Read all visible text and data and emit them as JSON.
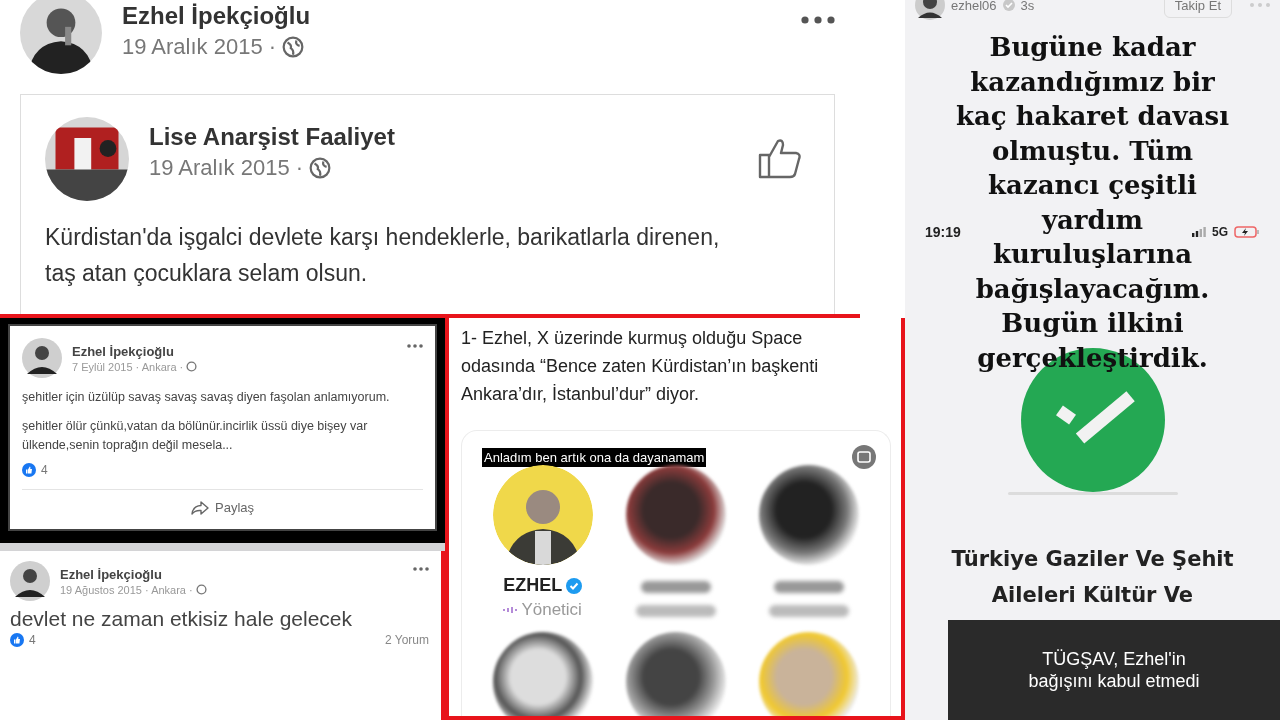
{
  "main_post": {
    "author": "Ezhel İpekçioğlu",
    "date": "19 Aralık 2015 ·",
    "shared_post": {
      "author": "Lise Anarşist Faaliyet",
      "date": "19 Aralık 2015 ·",
      "text": "Kürdistan'da işgalci devlete karşı hendeklerle, barikatlarla direnen, taş atan çocuklara selam olsun."
    }
  },
  "post_2": {
    "author": "Ezhel İpekçioğlu",
    "date": "7 Eylül 2015 · Ankara ·",
    "paragraphs": [
      "şehitler için üzülüp savaş savaş savaş diyen faşolan anlamıyorum.",
      "şehitler ölür çünkü,vatan da bölünür.incirlik üssü diye bişey var ülkende,senin toprağın değil mesela..."
    ],
    "reactions": "4",
    "share_label": "Paylaş"
  },
  "post_3": {
    "author": "Ezhel İpekçioğlu",
    "date": "19 Ağustos 2015 · Ankara ·",
    "text": "devlet ne zaman etkisiz hale gelecek",
    "reactions": "4",
    "comments": "2 Yorum"
  },
  "tweet": {
    "text": "1- Ezhel, X üzerinde kurmuş olduğu Space odasında “Bence zaten Kürdistan’ın başkenti Ankara’dır, İstanbul’dur” diyor.",
    "space": {
      "subtitle": "Anladım ben artık ona da dayanamam",
      "host": {
        "name": "EZHEL",
        "role": "Yönetici"
      }
    }
  },
  "story": {
    "username": "ezhel06",
    "time": "3s",
    "follow_label": "Takip Et",
    "text_lines": [
      "Bugüne kadar",
      "kazandığımız bir",
      "kaç hakaret davası",
      "olmuştu. Tüm",
      "kazancı çeşitli",
      "yardım",
      "kuruluşlarına",
      "bağışlayacağım.",
      "Bugün ilkini",
      "gerçekleştirdik."
    ],
    "status_bar": {
      "time": "19:19",
      "network": "5G"
    },
    "receipt_lines": [
      "Türkiye Gaziler Ve Şehit",
      "Aileleri Kültür Ve"
    ]
  },
  "caption": "TÜGŞAV, Ezhel'in bağışını kabul etmedi"
}
